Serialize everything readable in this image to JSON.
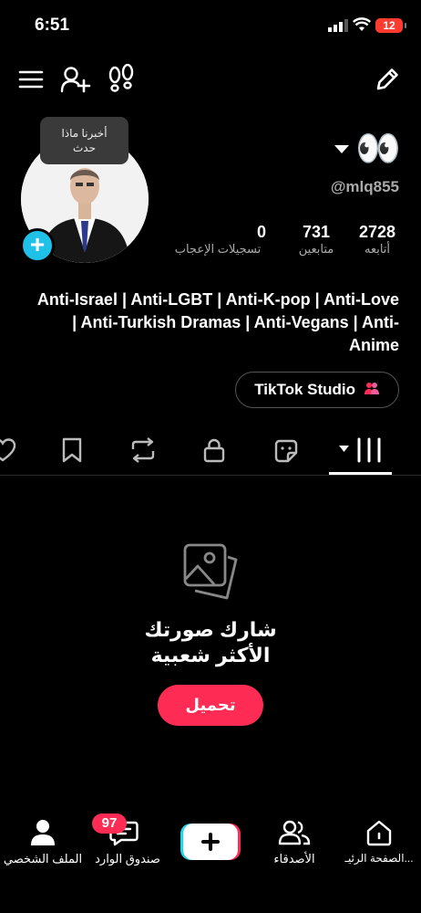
{
  "status_bar": {
    "time": "6:51",
    "battery": "12"
  },
  "header": {
    "menu_icon": "menu-icon",
    "add_friend_icon": "add-friend-icon",
    "footprints_icon": "footprints-icon",
    "edit_icon": "pencil-icon"
  },
  "profile": {
    "tooltip": "أخبرنا ماذا حدث",
    "name_emoji": "👀",
    "username": "@mlq855",
    "stats": [
      {
        "value": "2728",
        "label": "أتابعه"
      },
      {
        "value": "731",
        "label": "متابعين"
      },
      {
        "value": "0",
        "label": "تسجيلات الإعجاب"
      }
    ],
    "bio": "Anti-Israel | Anti-LGBT | Anti-K-pop | Anti-Love | Anti-Turkish Dramas | Anti-Vegans | Anti-Anime",
    "studio_button": "TikTok Studio"
  },
  "tabs": [
    "grid-icon",
    "stickers-icon",
    "lock-icon",
    "repost-icon",
    "bookmark-icon",
    "heart-icon"
  ],
  "empty_state": {
    "icon": "photos-icon",
    "title": "شارك صورتك الأكثر شعبية",
    "button": "تحميل"
  },
  "bottom_nav": {
    "home": "الصفحة الرئيـ...",
    "friends": "الأصدقاء",
    "inbox": "صندوق الوارد",
    "inbox_badge": "97",
    "profile": "الملف الشخصي"
  },
  "colors": {
    "accent": "#fe2c55",
    "cyan": "#20c1e8",
    "background": "#000000"
  }
}
